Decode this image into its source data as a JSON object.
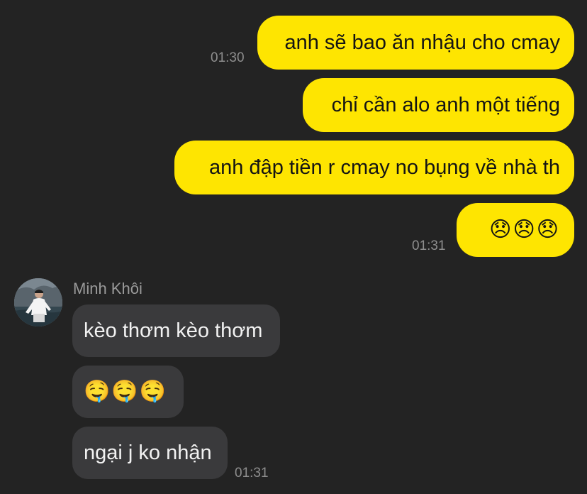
{
  "outgoing": [
    {
      "text": "anh sẽ bao ăn nhậu cho cmay"
    },
    {
      "text": "chỉ cần alo anh một tiếng"
    },
    {
      "text": "anh đập tiền r cmay no bụng về nhà th"
    },
    {
      "text": "😞😞😞"
    }
  ],
  "outgoing_times": [
    "01:30",
    "01:31"
  ],
  "incoming": {
    "sender": "Minh Khôi",
    "messages": [
      {
        "text": "kèo thơm kèo thơm"
      },
      {
        "text": "🤤🤤🤤"
      },
      {
        "text": "ngại j ko nhận"
      }
    ],
    "time": "01:31"
  },
  "colors": {
    "background": "#232323",
    "outgoing_bubble": "#fee501",
    "incoming_bubble": "#3a3a3c",
    "timestamp": "#8e8e8e"
  },
  "icons": [
    "avatar-photo"
  ]
}
